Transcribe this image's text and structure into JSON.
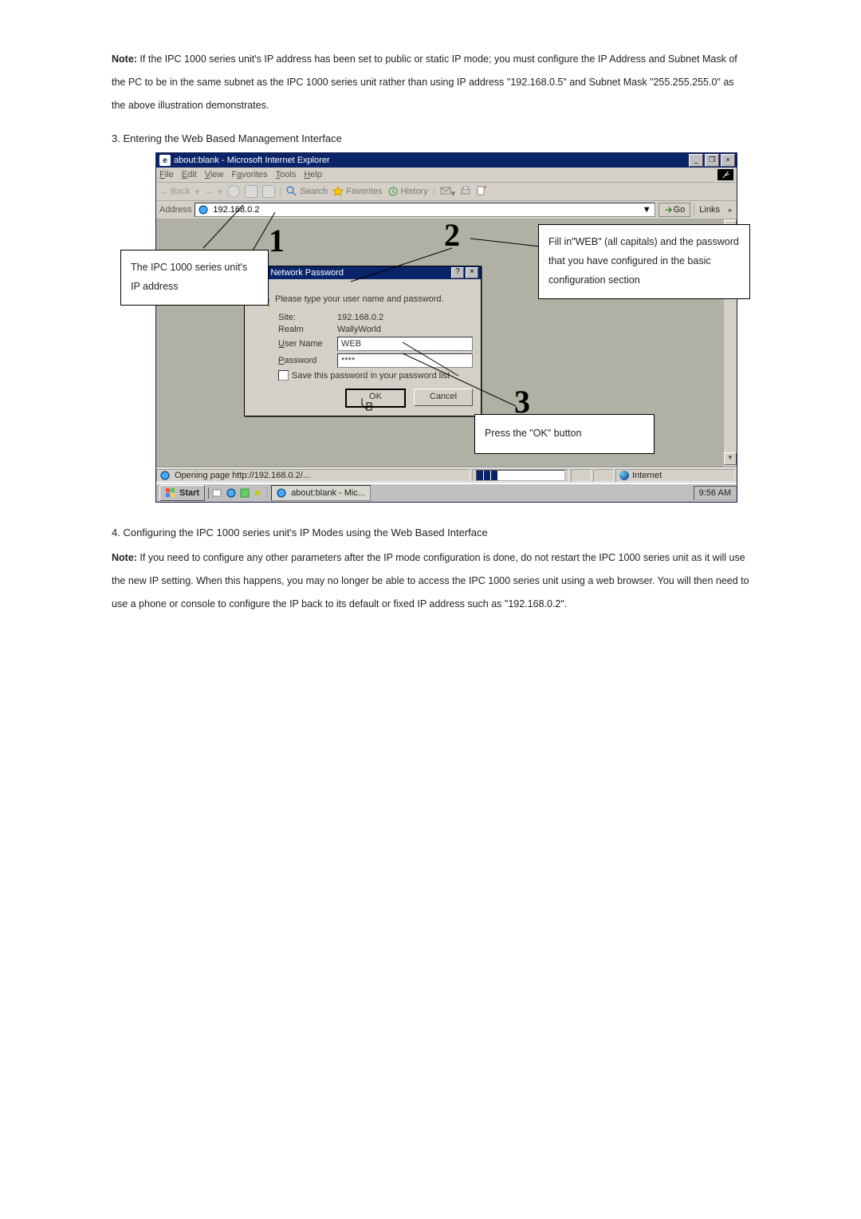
{
  "doc": {
    "note1_label": "Note:",
    "note1_text": " If the IPC 1000 series unit's IP address has been set to public or static IP mode; you must configure the IP Address and Subnet Mask of the PC to be in the same subnet as the IPC 1000 series unit rather than using IP address \"192.168.0.5\" and Subnet Mask \"255.255.255.0\" as the above illustration demonstrates.",
    "section3_title": "3. Entering the Web Based Management Interface",
    "section4_title": "4. Configuring the IPC 1000 series unit's IP Modes using the Web Based Interface",
    "note2_label": "Note:",
    "note2_text": " If you need to configure any other parameters after the IP mode configuration is done, do not restart the IPC 1000 series unit as it will use the new IP setting. When this happens, you may no longer be able to access the IPC 1000 series unit using a web browser. You will then need to use a phone or console to configure the IP back to its default or fixed IP address such as \"192.168.0.2\"."
  },
  "callouts": {
    "c1": "The IPC 1000 series unit's IP address",
    "c2": "Fill in\"WEB\" (all capitals) and the password that you have configured in the basic configuration section",
    "c3": "Press the \"OK\" button",
    "n1": "1",
    "n2": "2",
    "n3": "3"
  },
  "ie": {
    "title": "about:blank - Microsoft Internet Explorer",
    "win_min": "_",
    "win_max": "❐",
    "win_close": "×",
    "menu": {
      "file": "File",
      "edit": "Edit",
      "view": "View",
      "favorites": "Favorites",
      "tools": "Tools",
      "help": "Help"
    },
    "toolbar": {
      "back": "Back",
      "search": "Search",
      "favorites": "Favorites",
      "history": "History"
    },
    "address_label": "Address",
    "address_value": "192.168.0.2",
    "go_label": "Go",
    "links_label": "Links",
    "status_text": "Opening page http://192.168.0.2/...",
    "zone_label": "Internet"
  },
  "dialog": {
    "title": "Enter Network Password",
    "prompt": "Please type your user name and password.",
    "site_label": "Site:",
    "site_value": "192.168.0.2",
    "realm_label": "Realm",
    "realm_value": "WallyWorld",
    "user_label_pre": "U",
    "user_label_post": "ser Name",
    "user_value": "WEB",
    "pass_label_pre": "P",
    "pass_label_post": "assword",
    "pass_value": "****",
    "save_label_pre": "S",
    "save_label_post": "ave this password in your password list",
    "ok": "OK",
    "cancel": "Cancel",
    "help_btn": "?",
    "close_btn": "×"
  },
  "taskbar": {
    "start": "Start",
    "task": "about:blank - Mic...",
    "clock": "9:56 AM"
  }
}
